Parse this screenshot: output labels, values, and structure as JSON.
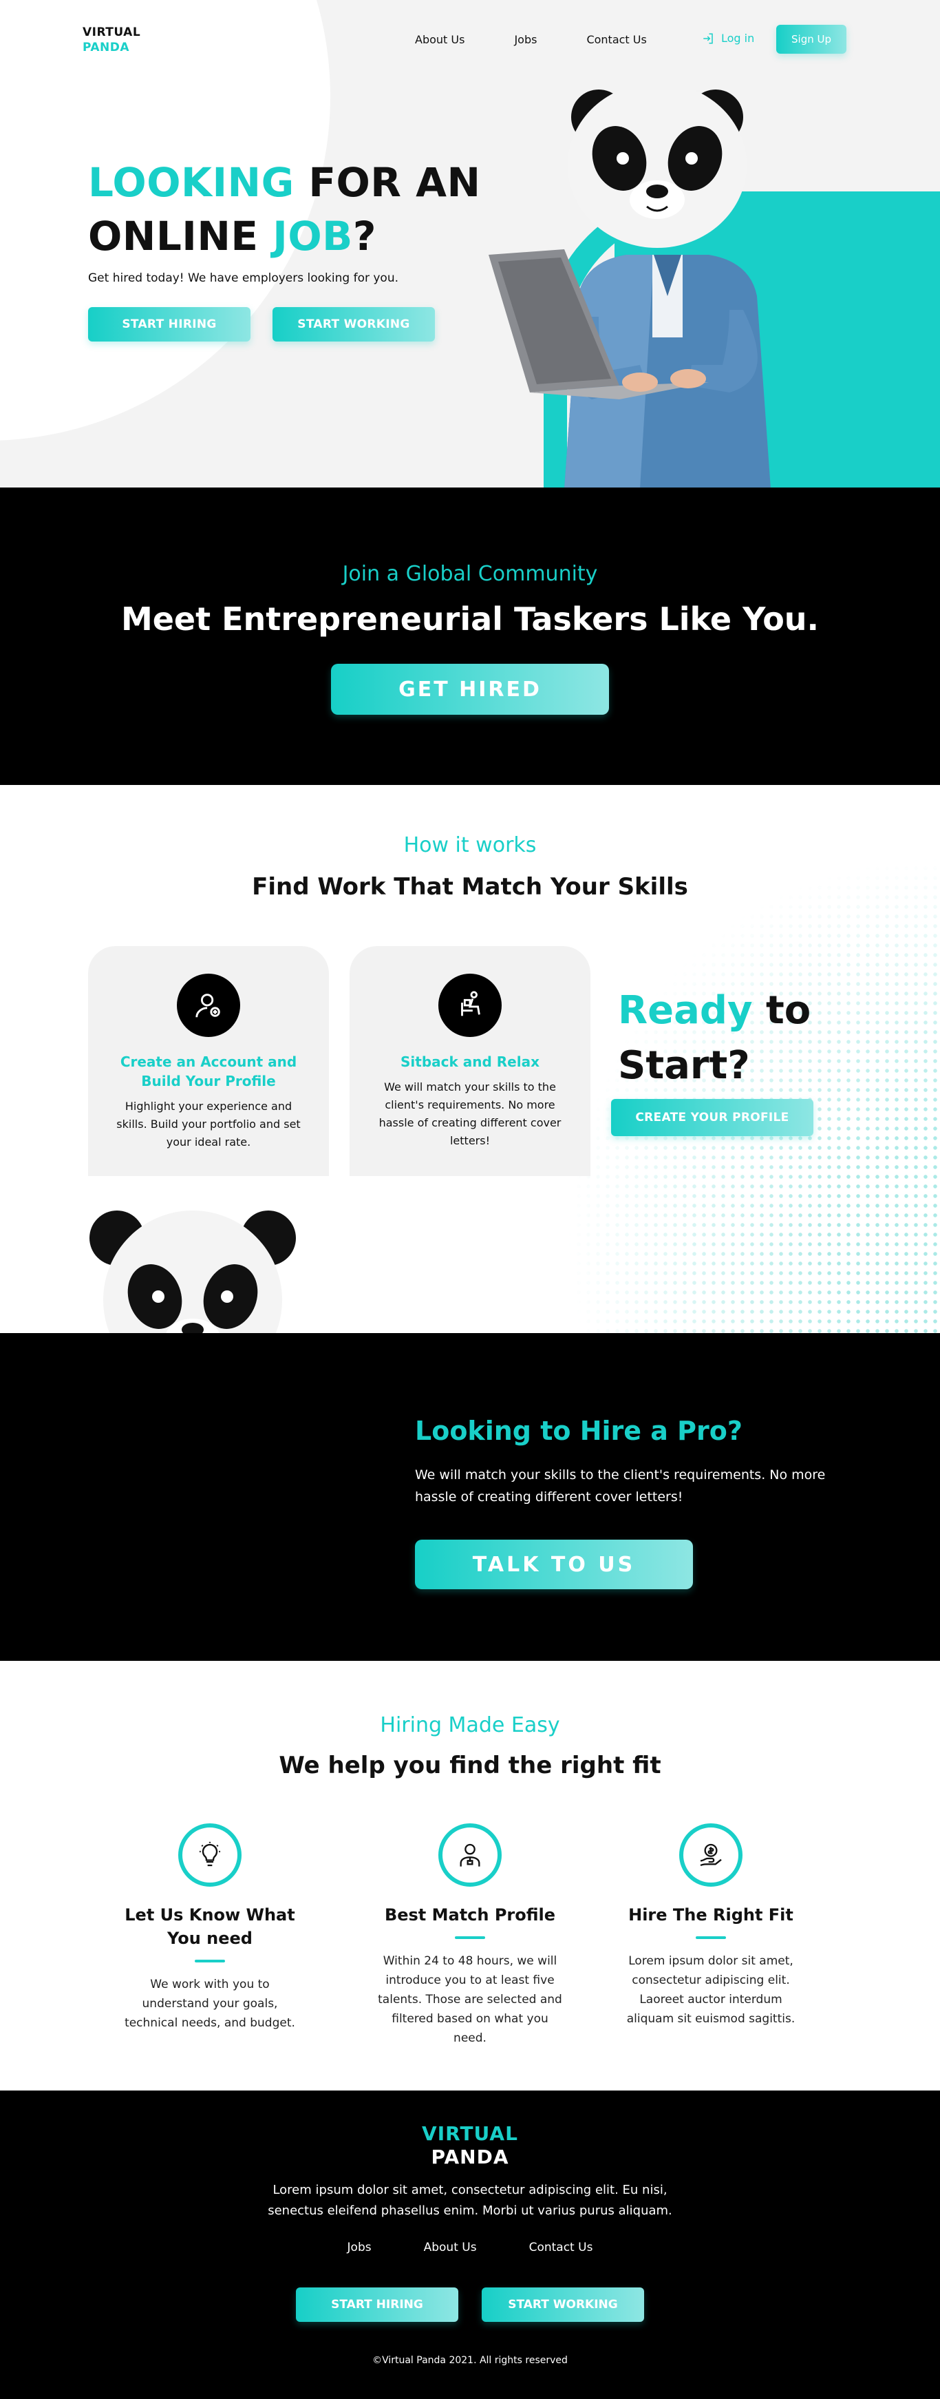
{
  "nav": {
    "logo_line1": "VIRTUAL",
    "logo_line2": "PANDA",
    "links": [
      "About Us",
      "Jobs",
      "Contact Us"
    ],
    "login_label": "Log in",
    "signup_label": "Sign Up"
  },
  "hero": {
    "title_w1": "LOOKING",
    "title_w2": " FOR AN",
    "title_w3": "ONLINE ",
    "title_w4": "JOB",
    "title_w5": "?",
    "subtitle": "Get hired today! We have employers looking for you.",
    "btn_hire": "START HIRING",
    "btn_work": "START WORKING"
  },
  "community": {
    "kicker": "Join a Global Community",
    "title": "Meet Entrepreneurial Taskers Like You.",
    "button": "GET HIRED"
  },
  "how": {
    "kicker": "How it works",
    "title": "Find Work That Match Your Skills",
    "cards": [
      {
        "title": "Create an Account and Build Your Profile",
        "text": "Highlight your experience and skills. Build your portfolio and set your ideal rate.",
        "icon": "user-profile-icon"
      },
      {
        "title": "Sitback and Relax",
        "text": "We will match your skills to the client's requirements. No more hassle of creating different cover letters!",
        "icon": "relax-chair-icon"
      }
    ],
    "ready_w1": "Ready",
    "ready_w2": " to",
    "ready_w3": "Start?",
    "create_button": "CREATE YOUR PROFILE"
  },
  "pro": {
    "title": "Looking to Hire a Pro?",
    "text": "We will match your skills to the client's requirements. No more hassle of creating different cover letters!",
    "button": "TALK TO US"
  },
  "easy": {
    "kicker": "Hiring Made Easy",
    "title": "We help you find the right fit",
    "features": [
      {
        "title": "Let Us Know What You need",
        "text": "We work with you to understand your goals, technical needs, and budget.",
        "icon": "lightbulb-icon"
      },
      {
        "title": "Best Match Profile",
        "text": "Within 24 to 48 hours, we will introduce you to at least five talents. Those are selected and filtered based on what you need.",
        "icon": "professional-profile-icon"
      },
      {
        "title": "Hire The Right Fit",
        "text": "Lorem ipsum dolor sit amet, consectetur adipiscing elit. Laoreet auctor interdum aliquam sit euismod sagittis.",
        "icon": "hand-money-icon"
      }
    ]
  },
  "footer": {
    "logo_line1": "VIRTUAL",
    "logo_line2": "PANDA",
    "text": "Lorem ipsum dolor sit amet, consectetur adipiscing elit. Eu nisi, senectus eleifend phasellus enim. Morbi ut varius purus aliquam.",
    "links": [
      "Jobs",
      "About Us",
      "Contact Us"
    ],
    "btn_hire": "START HIRING",
    "btn_work": "START WORKING",
    "copyright": "©Virtual Panda 2021. All rights reserved"
  },
  "colors": {
    "accent": "#19cfc8",
    "dark": "#000000",
    "light_bg": "#f3f3f3"
  }
}
